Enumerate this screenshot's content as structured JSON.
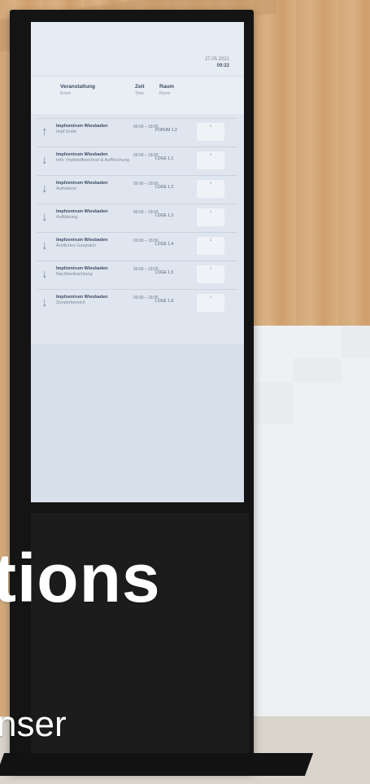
{
  "screen": {
    "date": "27.05.2021",
    "time": "09:22",
    "headers": {
      "event": "Veranstaltung",
      "event_sub": "Event",
      "time": "Zeit",
      "time_sub": "Time",
      "room": "Raum",
      "room_sub": "Room"
    },
    "rows": [
      {
        "arrow": "↑",
        "event": "Impfzentrum Wiesbaden",
        "desc": "Impf Ende",
        "time": "09:00 – 18:00",
        "room": "FORUM 1.3",
        "badge": "1"
      },
      {
        "arrow": "↓",
        "event": "Impfzentrum Wiesbaden",
        "desc": "Info: Impfstoffwechsel & Auffrischung",
        "time": "09:00 – 18:00",
        "room": "LOGE 1.1",
        "badge": "1"
      },
      {
        "arrow": "↓",
        "event": "Impfzentrum Wiesbaden",
        "desc": "Aufnahme",
        "time": "09:00 – 18:00",
        "room": "LOGE 1.2",
        "badge": "1"
      },
      {
        "arrow": "↓",
        "event": "Impfzentrum Wiesbaden",
        "desc": "Aufklärung",
        "time": "09:00 – 18:00",
        "room": "LOGE 1.3",
        "badge": "1"
      },
      {
        "arrow": "↓",
        "event": "Impfzentrum Wiesbaden",
        "desc": "Ärztliches Gespräch",
        "time": "09:00 – 18:00",
        "room": "LOGE 1.4",
        "badge": "1"
      },
      {
        "arrow": "↓",
        "event": "Impfzentrum Wiesbaden",
        "desc": "Nachbeobachtung",
        "time": "09:00 – 18:00",
        "room": "LOGE 1.5",
        "badge": "1"
      },
      {
        "arrow": "↓",
        "event": "Impfzentrum Wiesbaden",
        "desc": "Sonderbereich",
        "time": "09:00 – 18:00",
        "room": "LOGE 1.6",
        "badge": "1"
      }
    ]
  },
  "overlay": {
    "big": "tions",
    "small": "nser"
  }
}
